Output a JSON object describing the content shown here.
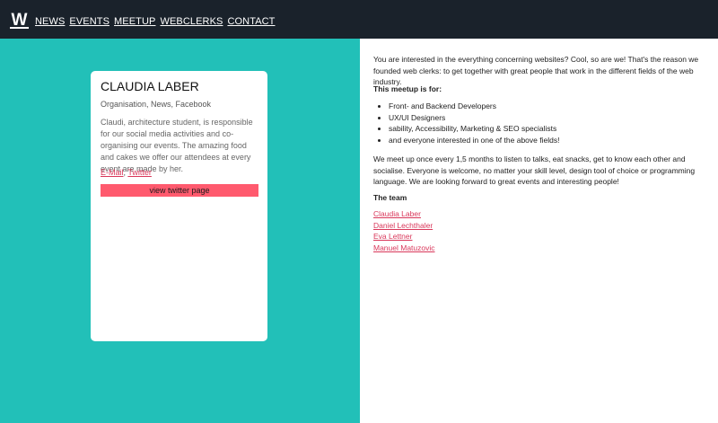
{
  "header": {
    "logo_letter": "W",
    "nav": [
      "NEWS",
      "EVENTS",
      "MEETUP",
      "WEBCLERKS",
      "CONTACT"
    ]
  },
  "profile": {
    "name": "CLAUDIA LABER",
    "roles": "Organisation, News, Facebook",
    "description": "Claudi, architecture student, is responsible for our social media activities and co-organising our events. The amazing food and cakes we offer our attendees at every event are made by her.",
    "links": [
      "E-Mail",
      "Twitter"
    ],
    "link_separator": ", ",
    "button_label": "view twitter page"
  },
  "about": {
    "intro": "You are interested in the everything concerning websites? Cool, so are we! That's the reason we founded web clerks: to get together with great people that work in the different fields of the web industry.",
    "meetup_heading": "This meetup is for:",
    "meetup_for": [
      "Front- and Backend Developers",
      "UX/UI Designers",
      "sability, Accessibility, Marketing & SEO specialists",
      "and everyone interested in one of the above fields!"
    ],
    "paragraph2": "We meet up once every 1,5 months to listen to talks, eat snacks, get to know each other and socialise. Everyone is welcome, no matter your skill level, design tool of choice or programming language. We are looking forward to great events and interesting people!",
    "team_heading": "The team",
    "team": [
      "Claudia Laber",
      "Daniel Lechthaler",
      "Eva Lettner",
      "Manuel Matuzovic"
    ]
  },
  "colors": {
    "header_bg": "#1a222b",
    "teal": "#22c0b8",
    "accent_pink": "#ff5a6e",
    "link": "#d9375a"
  }
}
